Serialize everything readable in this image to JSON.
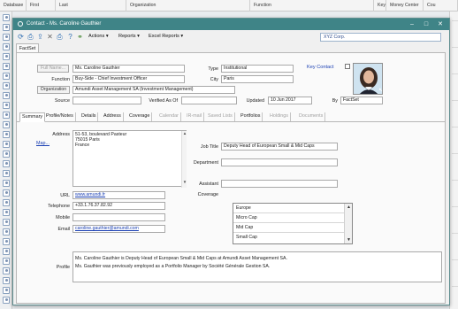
{
  "background": {
    "columns": [
      "Database",
      "First",
      "Last",
      "Organization",
      "Function",
      "Key",
      "Money Center",
      "Cou"
    ]
  },
  "window": {
    "title": "Contact - Ms. Caroline Gauthier",
    "minimize": "–",
    "maximize": "□",
    "close": "✕"
  },
  "toolbar": {
    "actions_label": "Actions ▾",
    "reports_label": "Reports ▾",
    "excel_reports_label": "Excel Reports ▾",
    "organization_field": "XYZ Corp."
  },
  "tab_label": "FactSet",
  "form": {
    "full_name_button": "Full Name...",
    "full_name": "Ms. Caroline Gauthier",
    "type_label": "Type",
    "type_value": "Institutional",
    "key_contact_label": "Key Contact",
    "function_label": "Function",
    "function_value": "Buy-Side - Chief Investment Officer",
    "city_label": "City",
    "city_value": "Paris",
    "organization_button": "Organization",
    "organization_value": "Amundi Asset Management SA (Investment Management)",
    "source_label": "Source",
    "source_value": "",
    "verified_label": "Verified As Of",
    "verified_value": "",
    "updated_label": "Updated",
    "updated_value": "10 Jun 2017",
    "by_label": "By",
    "by_value": "FactSet"
  },
  "subtabs": [
    {
      "label": "Summary",
      "state": "active"
    },
    {
      "label": "Profile/Notes",
      "state": "normal"
    },
    {
      "label": "Details",
      "state": "normal"
    },
    {
      "label": "Address",
      "state": "normal"
    },
    {
      "label": "Coverage",
      "state": "normal"
    },
    {
      "label": "Calendar",
      "state": "disabled"
    },
    {
      "label": "IR-mail",
      "state": "disabled"
    },
    {
      "label": "Saved Lists",
      "state": "disabled"
    },
    {
      "label": "Portfolios",
      "state": "normal"
    },
    {
      "label": "Holdings",
      "state": "disabled"
    },
    {
      "label": "Documents",
      "state": "disabled"
    }
  ],
  "summary": {
    "address_label": "Address",
    "address_lines": [
      "51-53, boulevard Pasteur",
      "75015 Paris",
      "France"
    ],
    "map_link": "Map...",
    "job_title_label": "Job Title",
    "job_title_value": "Deputy Head of European Small & Mid Caps",
    "department_label": "Department",
    "department_value": "",
    "assistant_label": "Assistant",
    "assistant_value": "",
    "coverage_label": "Coverage",
    "coverage_items": [
      "Europe",
      "Micro Cap",
      "Mid Cap",
      "Small Cap"
    ],
    "url_label": "URL",
    "url_value": "www.amundi.fr",
    "telephone_label": "Telephone",
    "telephone_value": "+33.1.76.37.82.92",
    "mobile_label": "Mobile",
    "mobile_value": "",
    "email_label": "Email",
    "email_value": "caroline.gauthier@amundi.com",
    "profile_label": "Profile",
    "profile_lines": [
      "Ms. Caroline Gauthier is Deputy Head of European Small & Mid Caps at Amundi Asset Management SA.",
      "Ms. Gauthier was previously employed as a Portfolio Manager by Société Générale Gestion SA."
    ]
  }
}
